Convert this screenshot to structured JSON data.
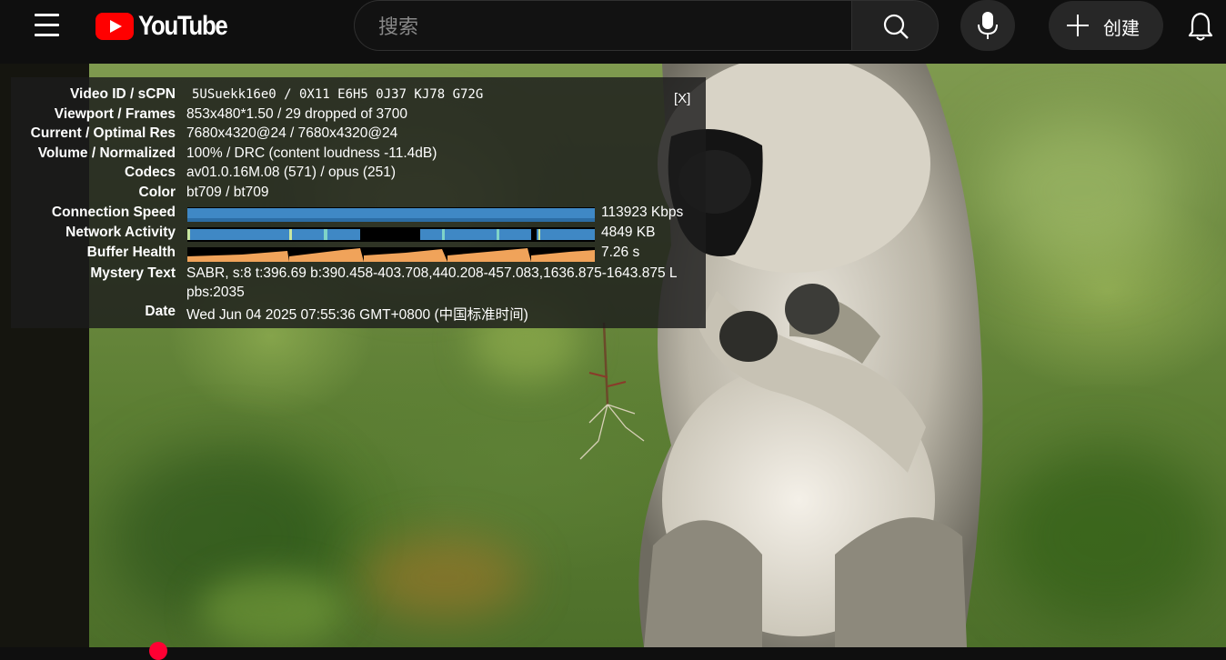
{
  "masthead": {
    "logo_text": "YouTube",
    "search_placeholder": "搜索",
    "create_label": "创建",
    "icons": [
      "menu-icon",
      "youtube-logo",
      "search-icon",
      "mic-icon",
      "plus-icon",
      "bell-icon"
    ]
  },
  "stats": {
    "close_label": "[X]",
    "rows": [
      {
        "label": "Video ID / sCPN",
        "value": "5USuekk16e0 / 0X11 E6H5 0J37 KJ78 G72G"
      },
      {
        "label": "Viewport / Frames",
        "value": "853x480*1.50 / 29 dropped of 3700"
      },
      {
        "label": "Current / Optimal Res",
        "value": "7680x4320@24 / 7680x4320@24"
      },
      {
        "label": "Volume / Normalized",
        "value": "100% / DRC (content loudness -11.4dB)"
      },
      {
        "label": "Codecs",
        "value": "av01.0.16M.08 (571) / opus (251)"
      },
      {
        "label": "Color",
        "value": "bt709 / bt709"
      },
      {
        "label": "Connection Speed",
        "value": "113923 Kbps"
      },
      {
        "label": "Network Activity",
        "value": "4849 KB"
      },
      {
        "label": "Buffer Health",
        "value": "7.26 s"
      },
      {
        "label": "Mystery Text",
        "value": "SABR, s:8 t:396.69 b:390.458-403.708,440.208-457.083,1636.875-1643.875 L",
        "value2": "pbs:2035"
      },
      {
        "label": "Date",
        "value": "Wed Jun 04 2025 07:55:36 GMT+0800 (中国标准时间)"
      }
    ]
  },
  "colors": {
    "masthead_bg": "#0f0f0f",
    "brand_red": "#ff0000",
    "graph_blue": "#3f88c5",
    "graph_orange": "#f0a35a"
  }
}
